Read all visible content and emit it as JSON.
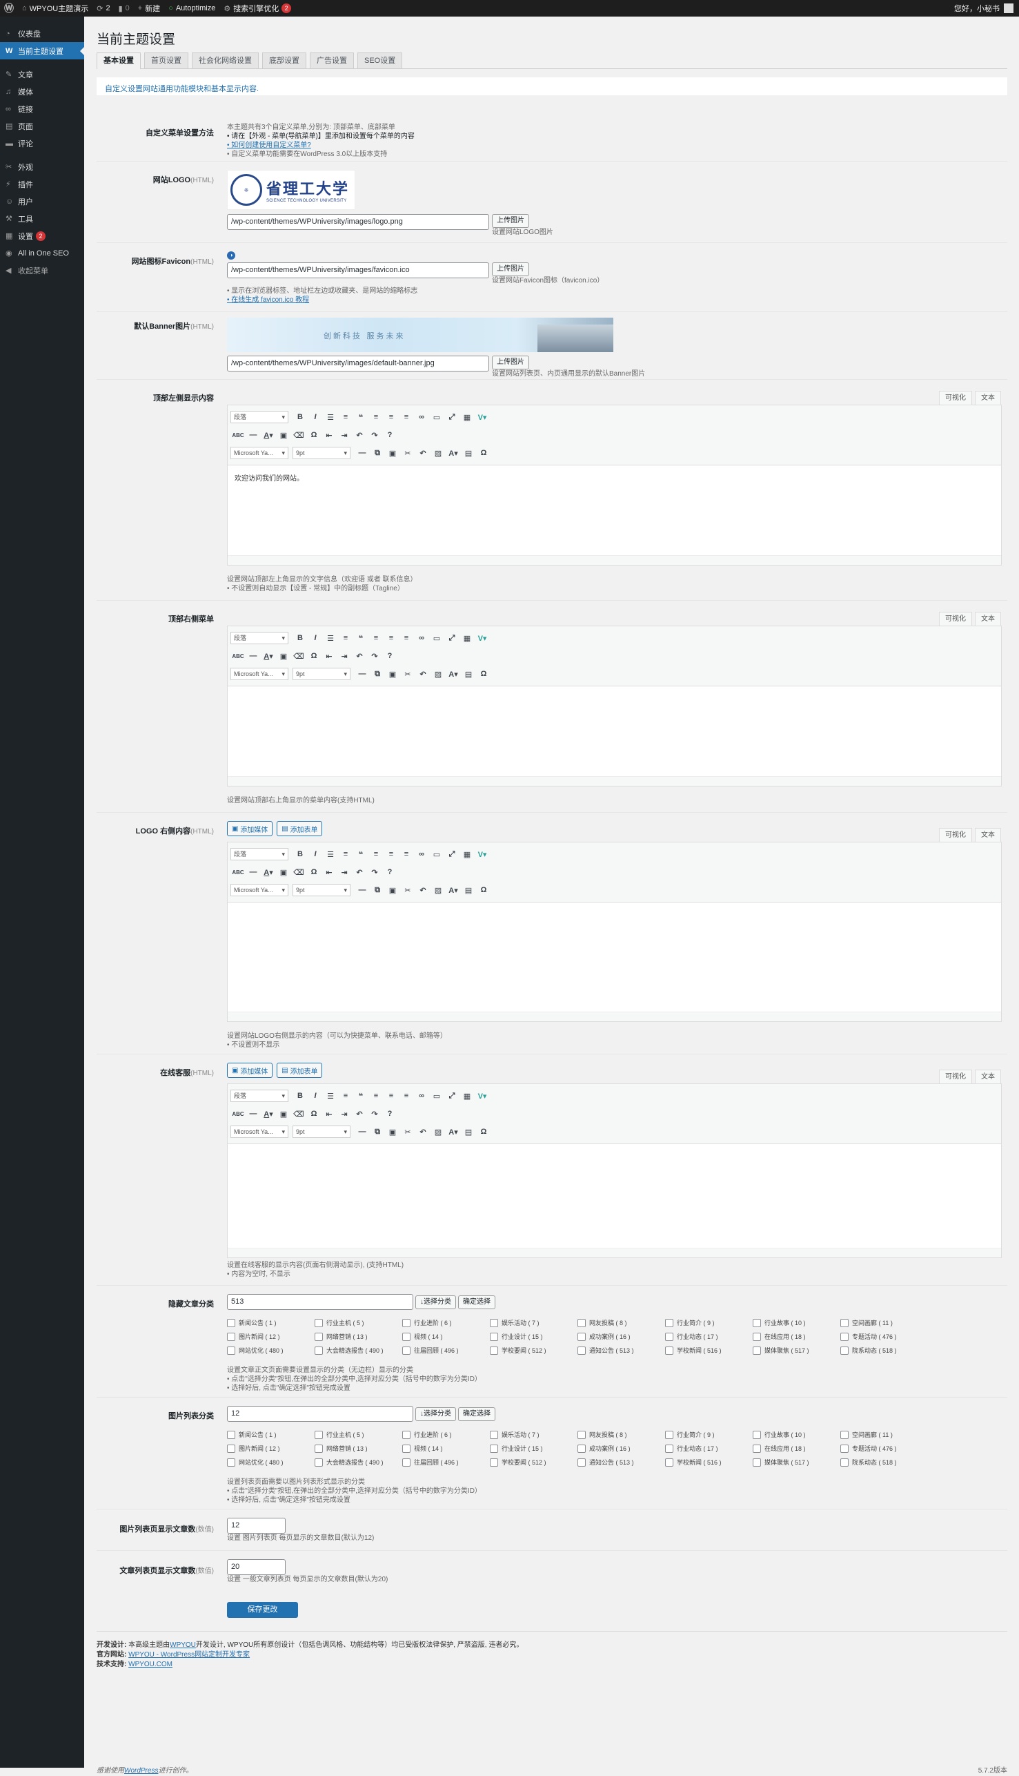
{
  "adminbar": {
    "site_name": "WPYOU主题演示",
    "updates_count": "2",
    "comments_count": "0",
    "new_label": "新建",
    "autoptimize": "Autoptimize",
    "seo_label": "搜索引擎优化",
    "seo_badge": "2",
    "greeting": "您好，小秘书"
  },
  "sidebar": {
    "items": [
      {
        "icon": "dashboard-icon",
        "label": "仪表盘"
      },
      {
        "icon": "theme-settings-icon",
        "label": "当前主题设置"
      },
      {
        "icon": "pin-icon",
        "label": "文章"
      },
      {
        "icon": "media-icon",
        "label": "媒体"
      },
      {
        "icon": "link-icon",
        "label": "链接"
      },
      {
        "icon": "page-icon",
        "label": "页面"
      },
      {
        "icon": "comment-icon",
        "label": "评论"
      },
      {
        "icon": "appearance-icon",
        "label": "外观"
      },
      {
        "icon": "plugin-icon",
        "label": "插件"
      },
      {
        "icon": "user-icon",
        "label": "用户"
      },
      {
        "icon": "tools-icon",
        "label": "工具"
      },
      {
        "icon": "settings-icon",
        "label": "设置",
        "badge": "2"
      },
      {
        "icon": "aioseo-icon",
        "label": "All in One SEO"
      },
      {
        "icon": "collapse-icon",
        "label": "收起菜单"
      }
    ]
  },
  "page": {
    "title": "当前主题设置",
    "tabs": [
      "基本设置",
      "首页设置",
      "社会化网络设置",
      "底部设置",
      "广告设置",
      "SEO设置"
    ],
    "intro": "自定义设置网站通用功能模块和基本显示内容."
  },
  "menu_setup": {
    "label": "自定义菜单设置方法",
    "line1": "本主题共有3个自定义菜单,分别为: 顶部菜单、底部菜单",
    "line2": "• 请在【外观 - 菜单(导航菜单)】里添加和设置每个菜单的内容",
    "line3": "• 如何创建使用自定义菜单?",
    "line4": "• 自定义菜单功能需要在WordPress 3.0以上版本支持"
  },
  "logo": {
    "label": "网站LOGO",
    "html_tag": "(HTML)",
    "logo_cn": "省理工大学",
    "logo_en": "SCIENCE TECHNOLOGY UNIVERSITY",
    "path": "/wp-content/themes/WPUniversity/images/logo.png",
    "upload": "上传图片",
    "hint": "设置网站LOGO图片"
  },
  "favicon": {
    "label": "网站图标Favicon",
    "html_tag": "(HTML)",
    "path": "/wp-content/themes/WPUniversity/images/favicon.ico",
    "upload": "上传图片",
    "hint": "设置网站Favicon图标（favicon.ico）",
    "desc1": "• 显示在浏览器标签、地址栏左边或收藏夹、是网站的缩略标志",
    "desc2": "• 在线生成 favicon.ico 教程"
  },
  "banner": {
    "label": "默认Banner图片",
    "html_tag": "(HTML)",
    "banner_text": "创新科技 服务未来",
    "path": "/wp-content/themes/WPUniversity/images/default-banner.jpg",
    "upload": "上传图片",
    "hint": "设置网站列表页、内页通用显示的默认Banner图片"
  },
  "editor_common": {
    "visual_tab": "可视化",
    "text_tab": "文本",
    "format_select": "段落",
    "font_select": "Microsoft Ya...",
    "size_select": "9pt",
    "add_media": "添加媒体",
    "add_form": "添加表单"
  },
  "top_left": {
    "label": "顶部左侧显示内容",
    "content": "欢迎访问我们的网站。",
    "desc1": "设置网站顶部左上角显示的文字信息（欢迎语 或者 联系信息）",
    "desc2": "• 不设置则自动显示【设置 - 常规】中的副标题（Tagline）"
  },
  "top_right": {
    "label": "顶部右侧菜单",
    "desc1": "设置网站顶部右上角显示的菜单内容(支持HTML)"
  },
  "logo_right": {
    "label": "LOGO 右侧内容",
    "html_tag": "(HTML)",
    "desc1": "设置网站LOGO右侧显示的内容（可以为快捷菜单、联系电话、邮箱等）",
    "desc2": "• 不设置则不显示"
  },
  "online_service": {
    "label": "在线客服",
    "html_tag": "(HTML)",
    "desc1": "设置在线客服的显示内容(页面右侧滑动显示), (支持HTML)",
    "desc2": "• 内容为空时, 不显示"
  },
  "cat_options": [
    "新闻公告 ( 1 )",
    "行业主机 ( 5 )",
    "行业进阶 ( 6 )",
    "娱乐活动 ( 7 )",
    "网友投稿 ( 8 )",
    "行业简介 ( 9 )",
    "行业故事 ( 10 )",
    "空间画廊 ( 11 )",
    "图片新闻 ( 12 )",
    "网络营销 ( 13 )",
    "视频 ( 14 )",
    "行业设计 ( 15 )",
    "成功案例 ( 16 )",
    "行业动态 ( 17 )",
    "在线应用 ( 18 )",
    "专题活动 ( 476 )",
    "网站优化 ( 480 )",
    "大会精选报告 ( 490 )",
    "往届回顾 ( 496 )",
    "学校要闻 ( 512 )",
    "通知公告 ( 513 )",
    "学校新闻 ( 516 )",
    "媒体聚焦 ( 517 )",
    "院系动态 ( 518 )"
  ],
  "home_cat": {
    "label": "隐藏文章分类",
    "value": "513",
    "choose": "↓选择分类",
    "confirm": "确定选择",
    "desc1": "设置文章正文页面需要设置显示的分类（无边栏）显示的分类",
    "desc2": "• 点击\"选择分类\"按钮,在弹出的全部分类中,选择对应分类（括号中的数字为分类ID）",
    "desc3": "• 选择好后, 点击\"确定选择\"按钮完成设置"
  },
  "img_cat": {
    "label": "图片列表分类",
    "value": "12",
    "choose": "↓选择分类",
    "confirm": "确定选择",
    "desc1": "设置列表页面需要以图片列表形式显示的分类",
    "desc2": "• 点击\"选择分类\"按钮,在弹出的全部分类中,选择对应分类（括号中的数字为分类ID）",
    "desc3": "• 选择好后, 点击\"确定选择\"按钮完成设置"
  },
  "img_count": {
    "label": "图片列表页显示文章数",
    "tag": "(数值)",
    "value": "12",
    "desc": "设置 图片列表页 每页显示的文章数目(默认为12)"
  },
  "post_count": {
    "label": "文章列表页显示文章数",
    "tag": "(数值)",
    "value": "20",
    "desc": "设置 一般文章列表页 每页显示的文章数目(默认为20)"
  },
  "save_label": "保存更改",
  "footer": {
    "dev_label": "开发设计:",
    "dev_text_a": "本高级主题由",
    "dev_link": "WPYOU",
    "dev_text_b": "开发设计, WPYOU所有原创设计（包括色调风格、功能结构等）均已受版权法律保护, 严禁盗版, 违者必究。",
    "site_label": "官方网站:",
    "site_link": "WPYOU - WordPress网站定制开发专家",
    "support_label": "技术支持:",
    "support_link": "WPYOU.COM",
    "thanks_a": "感谢使用",
    "thanks_link": "WordPress",
    "thanks_b": "进行创作。",
    "version": "5.7.2版本"
  }
}
